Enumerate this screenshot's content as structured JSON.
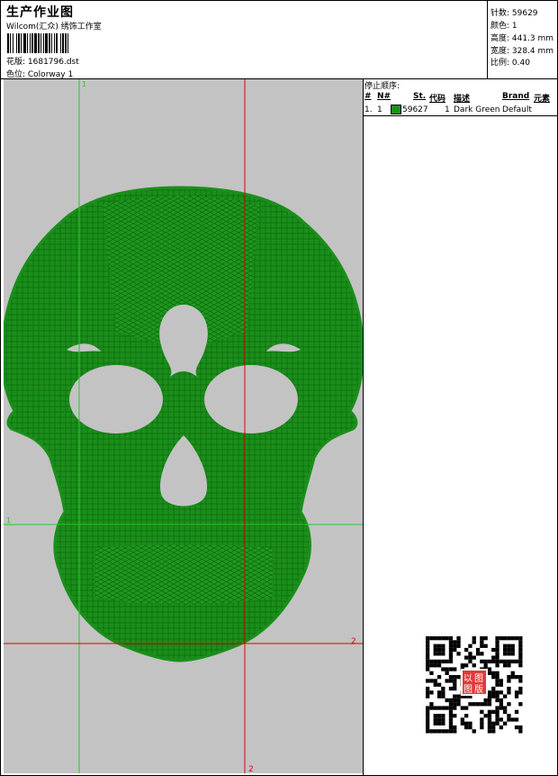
{
  "header": {
    "title": "生产作业图",
    "company": "Wilcom(汇众) 绣饰工作室",
    "design_line": "花版:  1681796.dst",
    "colorway_line": "色位:  Colorway 1"
  },
  "stats": {
    "stitches": "针数: 59629",
    "colors": "颜色: 1",
    "height": "高度: 441.3 mm",
    "width": "宽度: 328.4 mm",
    "scale": "比例: 0.40"
  },
  "stop_sequence": {
    "title": "停止顺序:",
    "headers": {
      "num": "#",
      "needle": "N#",
      "stitches": "St.",
      "code": "代码",
      "description": "描述",
      "brand": "Brand",
      "element": "元素"
    },
    "rows": [
      {
        "num": "1.",
        "needle": "1",
        "stitches": "59627",
        "code": "1",
        "description": "Dark Green",
        "brand": "Default"
      }
    ],
    "swatch_color": "#1a8f1a"
  },
  "guides": {
    "green_top_label": "1",
    "green_left_label": "1",
    "red_right_label": "2",
    "red_bottom_label": "2",
    "green_color": "#22cc22",
    "red_color": "#e00000"
  },
  "colors": {
    "canvas_bg": "#c3c3c3",
    "embroidery": "#1a8f1a"
  },
  "qr_icon": "qr-code-icon",
  "qr_stamp": {
    "chars": [
      "以",
      "图",
      "图",
      "版"
    ]
  }
}
